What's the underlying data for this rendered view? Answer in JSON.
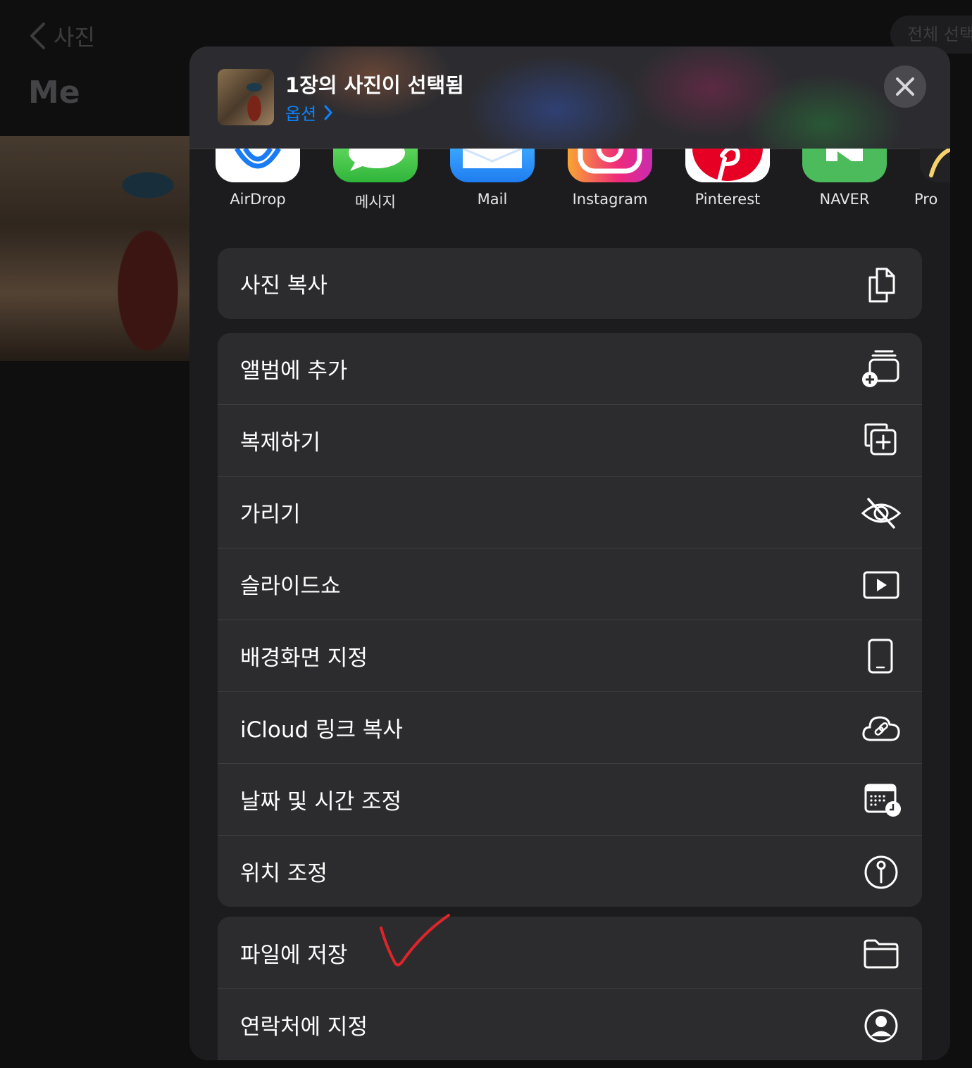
{
  "background": {
    "back_label": "사진",
    "title": "Me",
    "select_all": "전체 선택"
  },
  "header": {
    "selection_title": "1장의 사진이 선택됨",
    "options_label": "옵션"
  },
  "apps": [
    {
      "label": "AirDrop",
      "icon": "airdrop-icon"
    },
    {
      "label": "메시지",
      "icon": "messages-icon"
    },
    {
      "label": "Mail",
      "icon": "mail-icon"
    },
    {
      "label": "Instagram",
      "icon": "instagram-icon"
    },
    {
      "label": "Pinterest",
      "icon": "pinterest-icon"
    },
    {
      "label": "NAVER",
      "icon": "naver-icon"
    },
    {
      "label": "Pro",
      "icon": "procreate-icon"
    }
  ],
  "actions": {
    "copy_photo": "사진 복사",
    "add_to_album": "앨범에 추가",
    "duplicate": "복제하기",
    "hide": "가리기",
    "slideshow": "슬라이드쇼",
    "wallpaper": "배경화면 지정",
    "icloud_link": "iCloud 링크 복사",
    "adjust_date": "날짜 및 시간 조정",
    "adjust_location": "위치 조정",
    "save_to_files": "파일에 저장",
    "assign_contact": "연락처에 지정"
  },
  "colors": {
    "accent": "#0a84ff",
    "sheet": "#1c1c1e",
    "row": "#2c2c2e",
    "annotation": "#e0252a"
  }
}
